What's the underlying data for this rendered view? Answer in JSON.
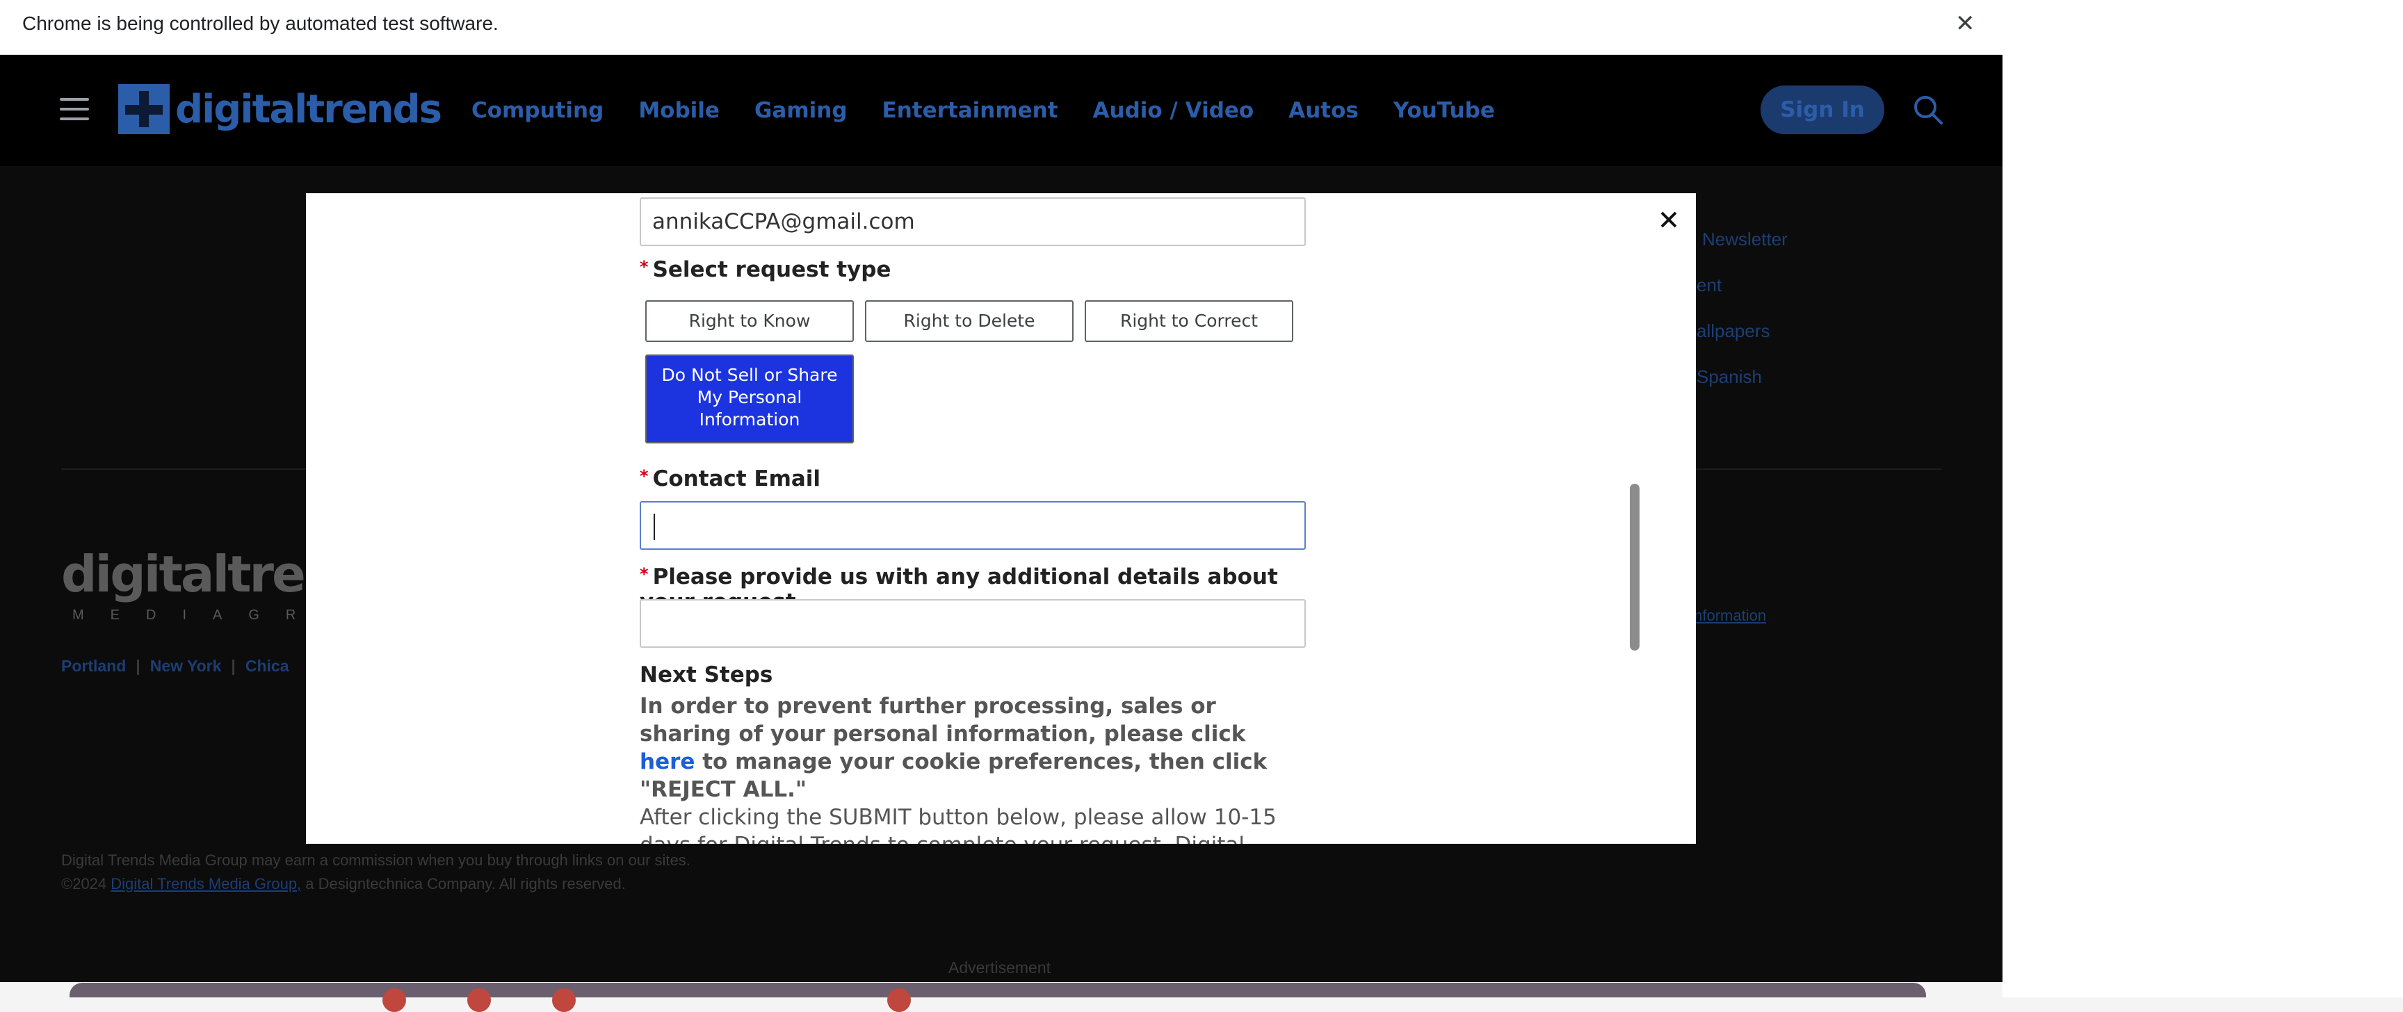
{
  "infobar": {
    "message": "Chrome is being controlled by automated test software.",
    "close_glyph": "✕"
  },
  "header": {
    "logo_text": "digitaltrends",
    "nav": [
      "Computing",
      "Mobile",
      "Gaming",
      "Entertainment",
      "Audio / Video",
      "Autos",
      "YouTube"
    ],
    "signin_label": "Sign In"
  },
  "background_links": [
    "Newsletter",
    "ent",
    "allpapers",
    "Spanish"
  ],
  "footer": {
    "logo_text": "digitaltrend",
    "logo_sub": "MEDIAGROU",
    "cities": [
      "Portland",
      "New York",
      "Chica"
    ],
    "privacy_link": "Information",
    "note_line1": "Digital Trends Media Group may earn a commission when you buy through links on our sites.",
    "note_copy": "©2024 ",
    "note_company_link": "Digital Trends Media Group,",
    "note_line2_rest": " a Designtechnica Company. All rights reserved.",
    "advert_label": "Advertisement"
  },
  "modal": {
    "email_value": "annikaCCPA@gmail.com",
    "request_type_label": "Select request type",
    "request_types": [
      "Right to Know",
      "Right to Delete",
      "Right to Correct"
    ],
    "selected_request": "Do Not Sell or Share My Personal Information",
    "contact_email_label": "Contact Email",
    "contact_email_value": "",
    "details_label": "Please provide us with any additional details about your request.",
    "details_value": "",
    "next_steps_title": "Next Steps",
    "next_steps_part1": "In order to prevent further processing, sales or sharing of your personal information, please click ",
    "next_steps_link": "here",
    "next_steps_part2": " to manage your cookie preferences, then click \"REJECT ALL.\"",
    "after_text": "After clicking the SUBMIT button below, please allow 10-15 days for Digital Trends to complete your request. Digital Trends may contact",
    "required_mark": "*",
    "close_glyph": "✕"
  },
  "colors": {
    "brand_blue": "#2b5da9",
    "selected_button": "#1c34e0",
    "link_blue": "#1c5fd8",
    "required_red": "#d0021b"
  }
}
